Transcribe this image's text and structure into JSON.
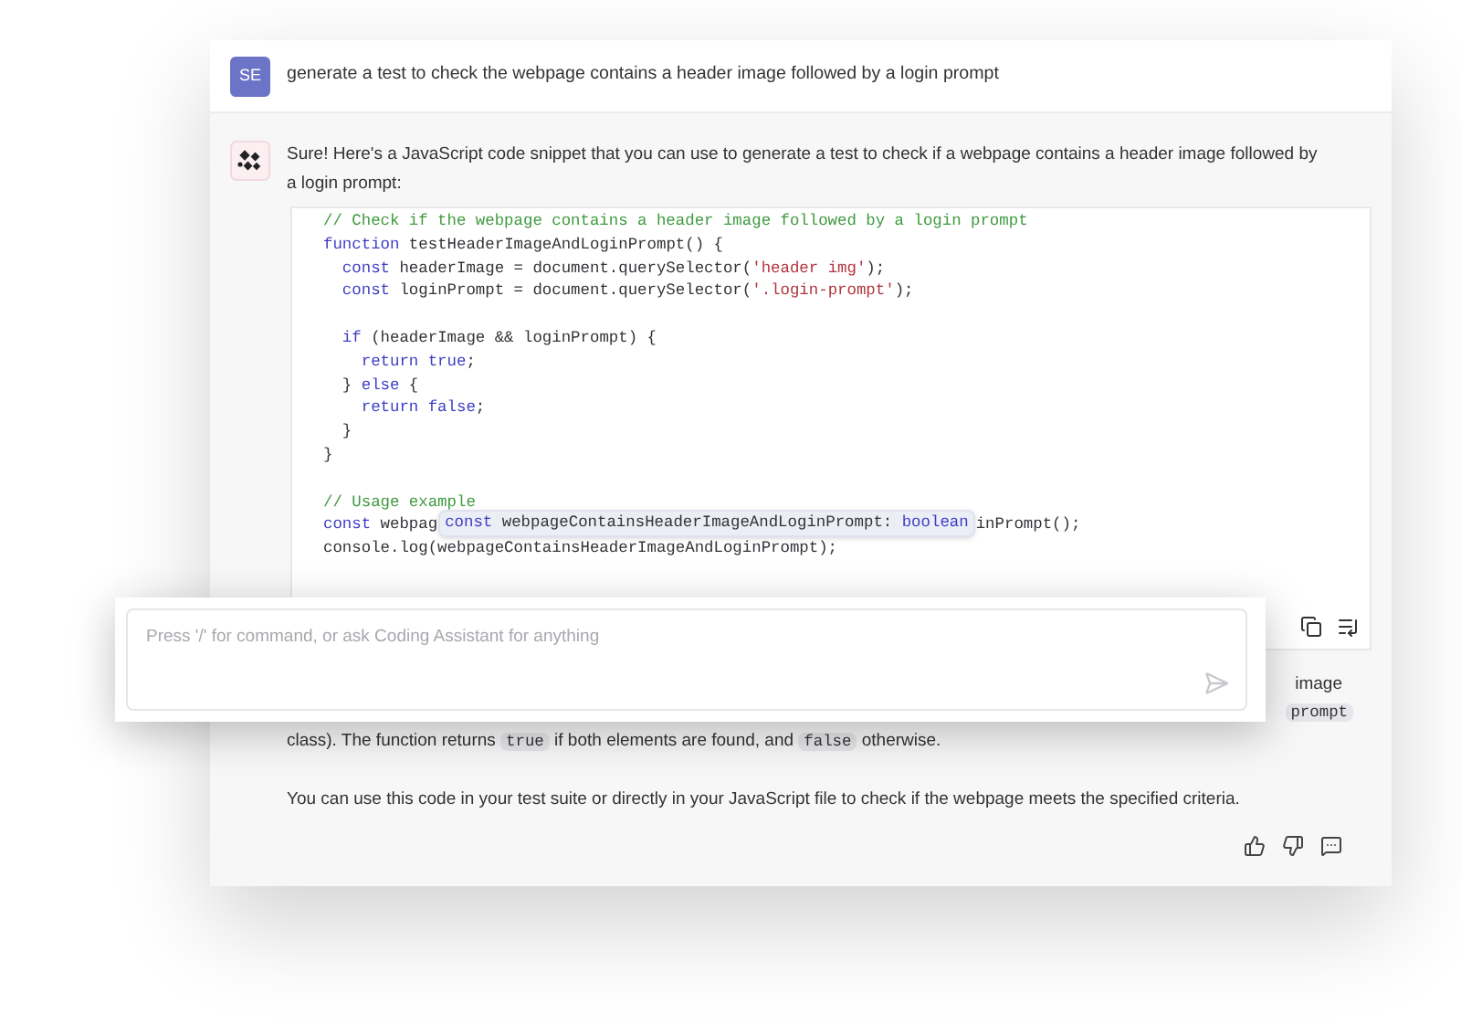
{
  "user_message": {
    "avatar": "SE",
    "text": "generate a test to check the webpage contains a header image followed by a login prompt"
  },
  "assistant_message": {
    "intro": "Sure! Here's a JavaScript code snippet that you can use to generate a test to check if a webpage contains a header image followed by a login prompt:",
    "code_lines": [
      {
        "kind": "code",
        "tokens": [
          {
            "kind": "comment",
            "text": "// Check if the webpage contains a header image followed by a login prompt"
          }
        ]
      },
      {
        "kind": "code",
        "tokens": [
          {
            "kind": "keyword",
            "text": "function"
          },
          {
            "kind": "plain",
            "text": " testHeaderImageAndLoginPrompt() {"
          }
        ]
      },
      {
        "kind": "code",
        "tokens": [
          {
            "kind": "keyword",
            "text": "  const"
          },
          {
            "kind": "plain",
            "text": " headerImage = document.querySelector("
          },
          {
            "kind": "string",
            "text": "'header img'"
          },
          {
            "kind": "plain",
            "text": ");"
          }
        ]
      },
      {
        "kind": "code",
        "tokens": [
          {
            "kind": "keyword",
            "text": "  const"
          },
          {
            "kind": "plain",
            "text": " loginPrompt = document.querySelector("
          },
          {
            "kind": "string",
            "text": "'.login-prompt'"
          },
          {
            "kind": "plain",
            "text": ");"
          }
        ]
      },
      {
        "kind": "blank"
      },
      {
        "kind": "code",
        "tokens": [
          {
            "kind": "keyword",
            "text": "  if"
          },
          {
            "kind": "plain",
            "text": " (headerImage && loginPrompt) {"
          }
        ]
      },
      {
        "kind": "code",
        "tokens": [
          {
            "kind": "keyword",
            "text": "    return true"
          },
          {
            "kind": "plain",
            "text": ";"
          }
        ]
      },
      {
        "kind": "code",
        "tokens": [
          {
            "kind": "plain",
            "text": "  } "
          },
          {
            "kind": "keyword",
            "text": "else"
          },
          {
            "kind": "plain",
            "text": " {"
          }
        ]
      },
      {
        "kind": "code",
        "tokens": [
          {
            "kind": "keyword",
            "text": "    return false"
          },
          {
            "kind": "plain",
            "text": ";"
          }
        ]
      },
      {
        "kind": "code",
        "tokens": [
          {
            "kind": "plain",
            "text": "  }"
          }
        ]
      },
      {
        "kind": "code",
        "tokens": [
          {
            "kind": "plain",
            "text": "}"
          }
        ]
      },
      {
        "kind": "blank"
      },
      {
        "kind": "code",
        "tokens": [
          {
            "kind": "comment",
            "text": "// Usage example"
          }
        ]
      },
      {
        "kind": "overlaid",
        "tokens": [
          {
            "kind": "keyword",
            "text": "const"
          },
          {
            "kind": "plain",
            "text": " webpag"
          }
        ],
        "tooltip": [
          {
            "kind": "keyword",
            "text": "const"
          },
          {
            "kind": "plain",
            "text": " webpageContainsHeaderImageAndLoginPrompt: "
          },
          {
            "kind": "keyword",
            "text": "boolean"
          }
        ],
        "tail": [
          {
            "kind": "plain",
            "text": "inPrompt();"
          }
        ]
      },
      {
        "kind": "code",
        "tokens": [
          {
            "kind": "plain",
            "text": "console.log(webpageContainsHeaderImageAndLoginPrompt);"
          }
        ]
      }
    ],
    "covered_fragments": [
      {
        "kind": "text",
        "text": "image"
      },
      {
        "kind": "code",
        "text": "prompt"
      }
    ],
    "explanation": [
      {
        "kind": "text",
        "text": "class). The function returns "
      },
      {
        "kind": "code",
        "text": "true"
      },
      {
        "kind": "text",
        "text": " if both elements are found, and "
      },
      {
        "kind": "code",
        "text": "false"
      },
      {
        "kind": "text",
        "text": " otherwise."
      }
    ],
    "closing": "You can use this code in your test suite or directly in your JavaScript file to check if the webpage meets the specified criteria."
  },
  "prompt_input": {
    "placeholder": "Press '/' for command, or ask Coding Assistant for anything"
  }
}
